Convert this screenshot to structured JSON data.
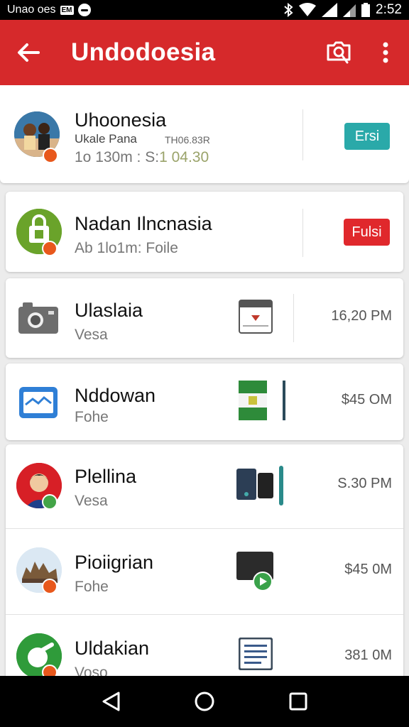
{
  "status_bar": {
    "left_text": "Unao oes",
    "box_label": "EM",
    "time": "2:52"
  },
  "app_bar": {
    "title": "Undodoesia",
    "icons": [
      "back-arrow-icon",
      "camera-search-icon",
      "more-vert-icon"
    ]
  },
  "items": [
    {
      "title": "Uhoonesia",
      "subtitle_left": "Ukale Pana",
      "subtitle_right": "TH06.83R",
      "line3_prefix": "1o 130m : S:",
      "line3_amount": "1 04.30",
      "action": "Ersi",
      "action_color": "#2aa9a9",
      "avatar_icon": "people-photo-avatar",
      "badge": "orange"
    },
    {
      "title": "Nadan Ilncnasia",
      "subtitle": "Ab 1lo1m: Foile",
      "action": "Fulsi",
      "action_color": "#e0282c",
      "avatar_icon": "shopping-bag-avatar",
      "badge": "orange"
    },
    {
      "title": "Ulaslaia",
      "subtitle": "Vesa",
      "time": "16,20 PM",
      "icon": "camera-icon",
      "thumb_icon": "calendar-thumb-icon"
    },
    {
      "title": "Nddowan",
      "subtitle": "Fohe",
      "time": "$45 OM",
      "icon": "mail-icon",
      "thumb_icon": "flag-thumb-icon"
    },
    {
      "title": "Plellina",
      "subtitle": "Vesa",
      "time": "S.30 PM",
      "avatar_icon": "person-avatar",
      "badge": "green",
      "thumb_icon": "devices-thumb-icon"
    },
    {
      "title": "Pioiigrian",
      "subtitle": "Fohe",
      "time": "$45 0M",
      "avatar_icon": "landmark-avatar",
      "badge": "orange",
      "thumb_icon": "video-thumb-icon"
    },
    {
      "title": "Uldakian",
      "subtitle": "Voso",
      "time": "381 0M",
      "avatar_icon": "shopping-bag-avatar",
      "badge": "orange",
      "thumb_icon": "document-thumb-icon"
    }
  ],
  "nav_bar": {
    "icons": [
      "nav-back-icon",
      "nav-home-icon",
      "nav-recents-icon"
    ]
  }
}
